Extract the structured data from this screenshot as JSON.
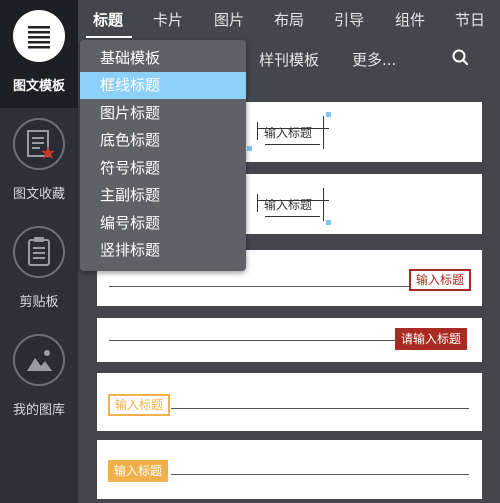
{
  "sidebar": {
    "items": [
      {
        "label": "图文模板",
        "icon": "template-list-icon",
        "active": true
      },
      {
        "label": "图文收藏",
        "icon": "favorites-star-icon",
        "active": false
      },
      {
        "label": "剪贴板",
        "icon": "clipboard-icon",
        "active": false
      },
      {
        "label": "我的图库",
        "icon": "image-gallery-icon",
        "active": false
      }
    ]
  },
  "tabs": [
    "标题",
    "卡片",
    "图片",
    "布局",
    "引导",
    "组件",
    "节日"
  ],
  "subtabs": {
    "journal": "样刊模板",
    "more": "更多...",
    "search_icon": "search-icon"
  },
  "dropdown": {
    "items": [
      "基础模板",
      "框线标题",
      "图片标题",
      "底色标题",
      "符号标题",
      "主副标题",
      "编号标题",
      "竖排标题"
    ],
    "highlighted": "框线标题"
  },
  "templates": [
    {
      "text": "输入标题",
      "style": "bracket-frame",
      "color": "#333333"
    },
    {
      "text": "输入标题",
      "style": "bracket-frame",
      "color": "#333333"
    },
    {
      "text": "输入标题",
      "style": "line-boxed-right",
      "color": "#a92a22"
    },
    {
      "text": "请输入标题",
      "style": "line-filled-right",
      "color": "#a92a22"
    },
    {
      "text": "输入标题",
      "style": "boxed-left-line",
      "color": "#f2b04d"
    },
    {
      "text": "输入标题",
      "style": "filled-left-line",
      "color": "#f2b04d"
    }
  ],
  "colors": {
    "sidebar": "#2e3037",
    "panel": "#43464d",
    "highlight": "#8dd0f7",
    "red": "#a92a22",
    "orange": "#f2b04d"
  }
}
